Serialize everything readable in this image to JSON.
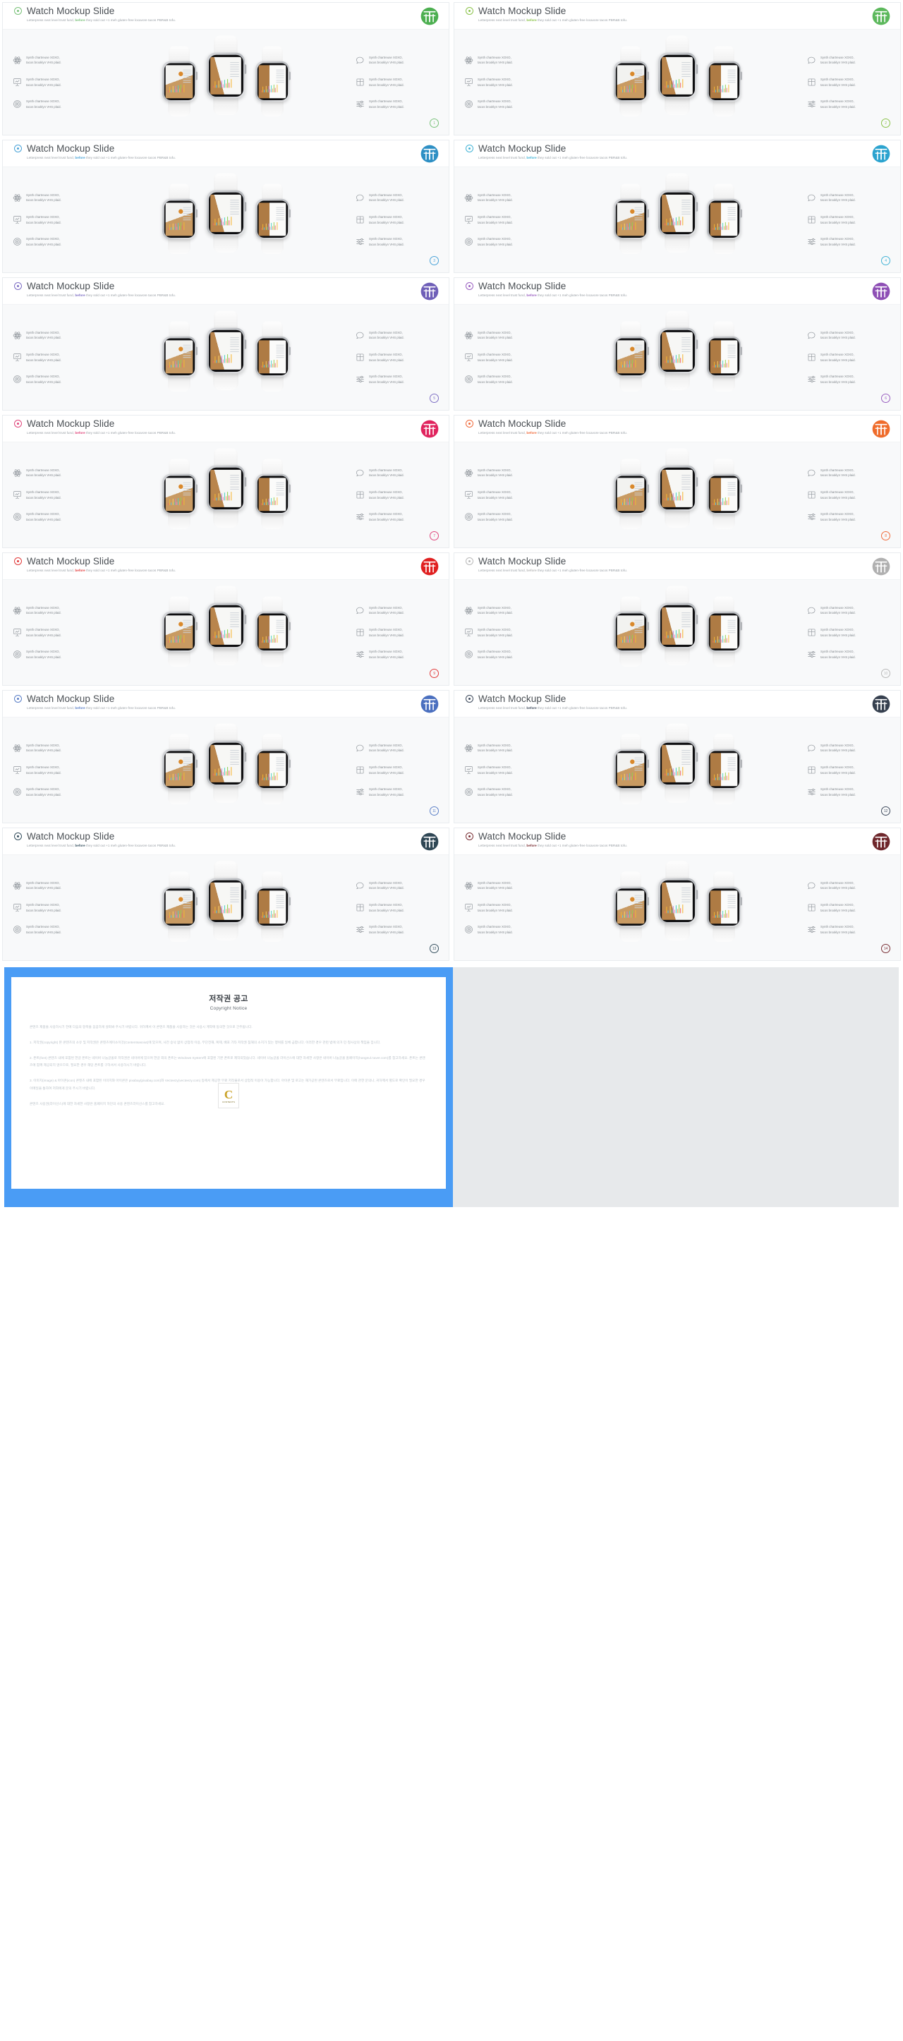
{
  "slide_common": {
    "title": "Watch Mockup Slide",
    "subtitle_pre": "Letterpress next level trust fund, ",
    "subtitle_hl": "before",
    "subtitle_post": " they sold out +1 meh gluten-free locavore tacos PBR&B tofu.",
    "bullet_line1": "Synth chartreuse XOXO,",
    "bullet_line2": "tacos brooklyn VHS plaid."
  },
  "left_bullet_icons": [
    "atom-icon",
    "presentation-chart-icon",
    "target-icon"
  ],
  "right_bullet_icons": [
    "chat-bubble-icon",
    "layout-grid-icon",
    "sliders-icon"
  ],
  "slides": [
    {
      "page": "1",
      "accent": "#7ac27a",
      "emblem": "#4caf50"
    },
    {
      "page": "2",
      "accent": "#8bc34a",
      "emblem": "#5cb85c"
    },
    {
      "page": "3",
      "accent": "#4aa3d8",
      "emblem": "#2d8fc4"
    },
    {
      "page": "4",
      "accent": "#43b3d6",
      "emblem": "#2ba3cf"
    },
    {
      "page": "5",
      "accent": "#7e6fc4",
      "emblem": "#6f5fb8"
    },
    {
      "page": "6",
      "accent": "#9a5fc0",
      "emblem": "#8e4fb5"
    },
    {
      "page": "7",
      "accent": "#e0457b",
      "emblem": "#e0245e"
    },
    {
      "page": "8",
      "accent": "#f06a3a",
      "emblem": "#ef6c2b"
    },
    {
      "page": "9",
      "accent": "#e23b3b",
      "emblem": "#e02020"
    },
    {
      "page": "10",
      "accent": "#b9b9b9",
      "emblem": "#b0b0b0"
    },
    {
      "page": "11",
      "accent": "#5b7fc7",
      "emblem": "#4a6fbf"
    },
    {
      "page": "12",
      "accent": "#3e4a5c",
      "emblem": "#36404f"
    },
    {
      "page": "13",
      "accent": "#36505f",
      "emblem": "#2e4654"
    },
    {
      "page": "14",
      "accent": "#7a2f34",
      "emblem": "#6e262b"
    }
  ],
  "copyright": {
    "title_ko": "저작권 공고",
    "title_en": "Copyright Notice",
    "paragraphs": [
      "콘텐츠 제품을 사용하시기 전에 다음의 항목을 꼼꼼하게 살펴봐 주시기 바랍니다. 귀하께서 이 콘텐츠 제품을 사용하는 것은 사용시 계약에 동의한 것으로 간주됩니다.",
      "1. 저작권(copyright) 본 콘텐츠의 소유 및 저작권은 콘텐츠에이소이것(Contentsasoiut)에 있으며, 사전 승낙 없이 상업적 이용, 무단전재, 복제, 배포 기타 저작권 침해의 소지가 있는 행위를 일체 금합니다. 이러한 경우 관련 법에 의거 민·형사상의 책임을 집니다.",
      "2. 폰트(font) 콘텐츠 내에 포함된 한글 폰트는 네이버 나눔글꼴로 저작권은 네이버에 있으며 한글 외의 폰트는 Windows System에 포함된 기본 폰트로 제작되었습니다. 네이버 나눔글꼴 라이선스에 대한 자세한 사항은 네이버 나눔글꼴 홈페이지(hangeul.naver.com)를 참고하세요. 폰트는 콘텐츠에 함께 제공되지 않으므로, 필요한 경우 해당 폰트를 구하셔서 사용하시기 바랍니다.",
      "3. 이미지(image) & 아이콘(icon) 콘텐츠 내에 포함된 이미지와 아이콘은 pixabay(pixabay.com)와 Vecteezy(vecteezy.com) 등에서 제공한 무료 저작물로서 상업적 이용이 가능합니다. 아이콘 및 로고는 재가공된 콘텐츠로서 무료입니다. 이에 관한 문의나, 귀하께서 별도로 확인이 필요한 경우 이메일을 통하여 저희에게 문의 주시기 바랍니다.",
      "콘텐츠 사용권(라이선스)에 대한 자세한 사항은 홈페이지 하단의 사용 콘텐츠라이선스를 참고하세요."
    ],
    "watermark_letter": "C",
    "watermark_label": "CONTENTS"
  }
}
